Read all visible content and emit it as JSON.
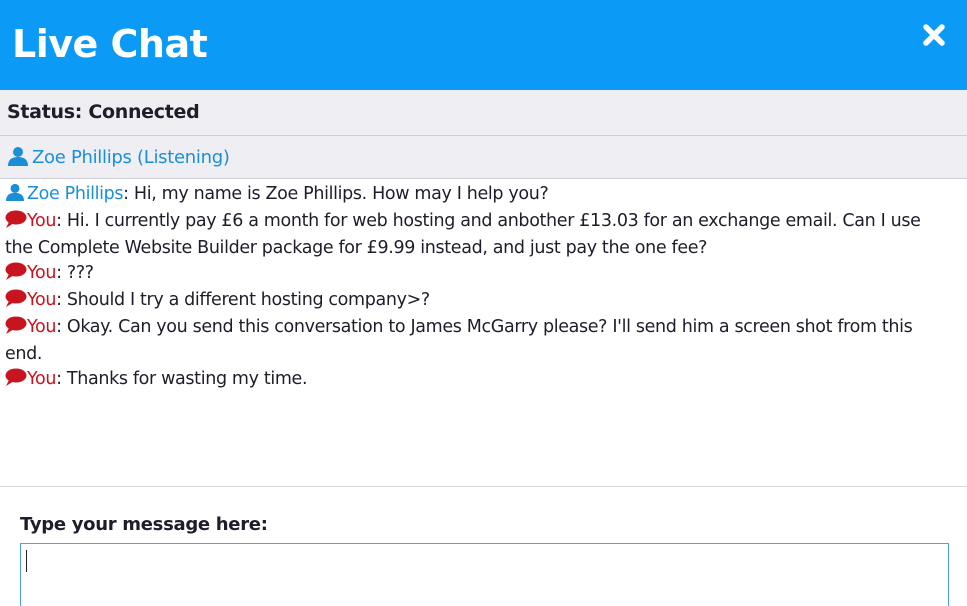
{
  "header": {
    "title": "Live Chat",
    "close_icon": "close-icon"
  },
  "status": {
    "text": "Status: Connected"
  },
  "agent_bar": {
    "label": "Zoe Phillips (Listening)",
    "icon": "person-icon"
  },
  "transcript": {
    "messages": [
      {
        "sender": "Zoe Phillips",
        "role": "agent",
        "icon": "person-icon",
        "text": "Hi, my name is Zoe Phillips. How may I help you?"
      },
      {
        "sender": "You",
        "role": "user",
        "icon": "speech-bubble-icon",
        "text": "Hi. I currently pay £6 a month for web hosting and anbother £13.03 for an exchange email. Can I use the Complete Website Builder package for £9.99 instead, and just pay the one fee?"
      },
      {
        "sender": "You",
        "role": "user",
        "icon": "speech-bubble-icon",
        "text": "???"
      },
      {
        "sender": "You",
        "role": "user",
        "icon": "speech-bubble-icon",
        "text": "Should I try a different hosting company>?"
      },
      {
        "sender": "You",
        "role": "user",
        "icon": "speech-bubble-icon",
        "text": "Okay. Can you send this conversation to James McGarry please? I'll send him a screen shot from this end."
      },
      {
        "sender": "You",
        "role": "user",
        "icon": "speech-bubble-icon",
        "text": "Thanks for wasting my time."
      }
    ]
  },
  "composer": {
    "label": "Type your message here:",
    "value": "",
    "placeholder": ""
  },
  "colors": {
    "header_bg": "#0b9af6",
    "bar_bg": "#eeeef3",
    "agent_name": "#1a8fd8",
    "user_name": "#c8141e",
    "input_border": "#4aa6de"
  }
}
